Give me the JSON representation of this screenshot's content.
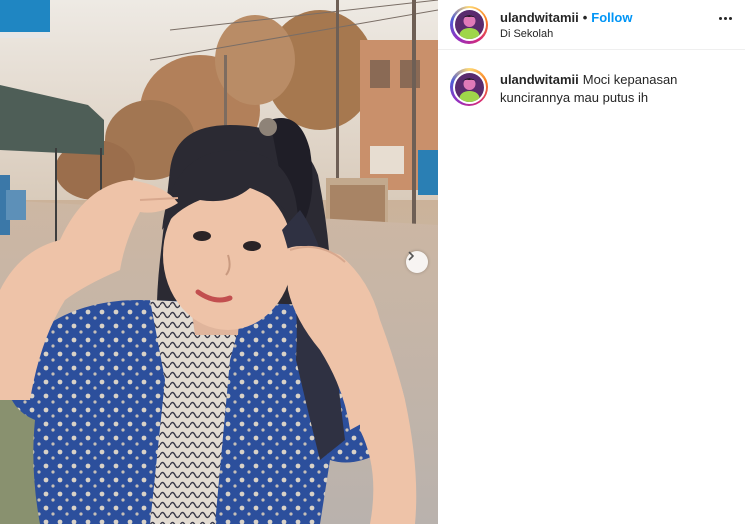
{
  "post": {
    "username": "ulandwitamii",
    "separator": "•",
    "follow_label": "Follow",
    "location": "Di Sekolah",
    "caption_line1": "Moci kepanasan",
    "caption_line2": "kuncirannya mau putus ih"
  },
  "icons": {
    "more": "more-options-icon",
    "next": "chevron-right-icon"
  },
  "colors": {
    "follow": "#0095f6",
    "text": "#262626",
    "divider": "#efefef"
  }
}
